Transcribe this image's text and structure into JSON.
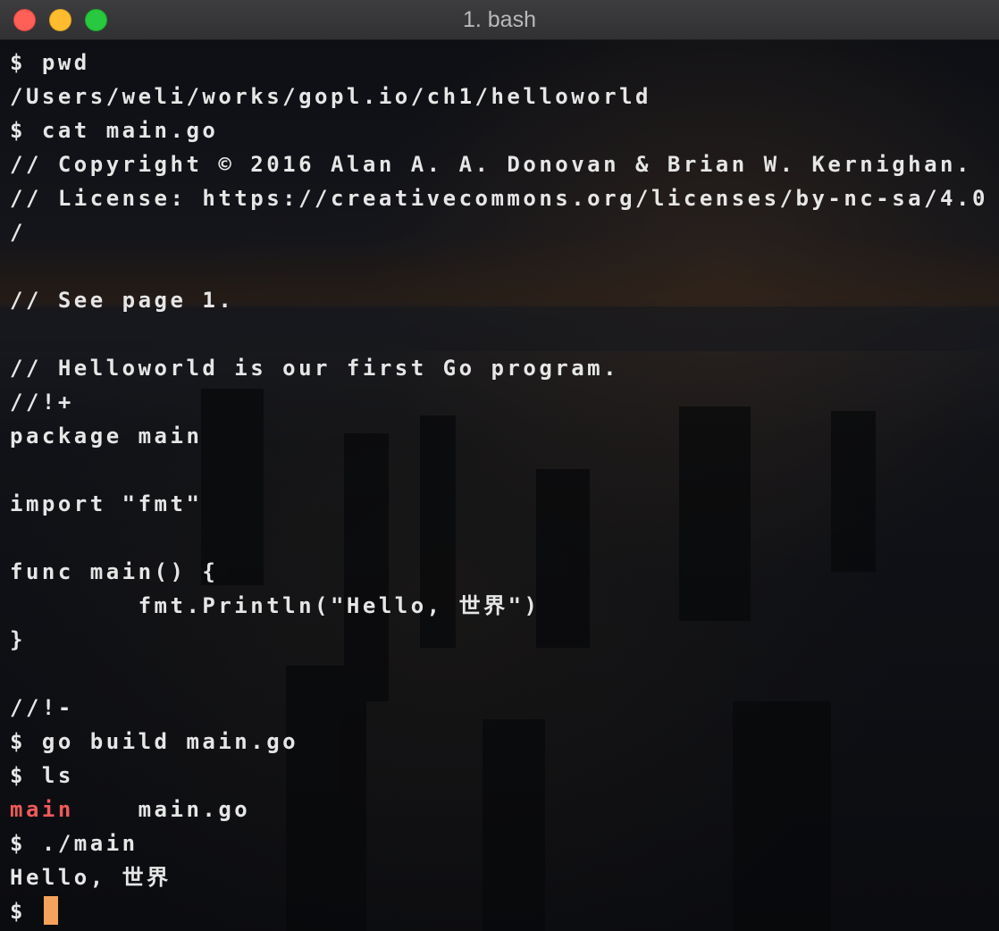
{
  "window": {
    "title": "1. bash"
  },
  "colors": {
    "text": "#e6e6e6",
    "executable": "#f05a5a",
    "cursor": "#f5a25c"
  },
  "terminal": {
    "lines": [
      "$ pwd",
      "/Users/weli/works/gopl.io/ch1/helloworld",
      "$ cat main.go",
      "// Copyright © 2016 Alan A. A. Donovan & Brian W. Kernighan.",
      "// License: https://creativecommons.org/licenses/by-nc-sa/4.0",
      "/",
      "",
      "// See page 1.",
      "",
      "// Helloworld is our first Go program.",
      "//!+",
      "package main",
      "",
      "import \"fmt\"",
      "",
      "func main() {",
      "        fmt.Println(\"Hello, 世界\")",
      "}",
      "",
      "//!-",
      "$ go build main.go",
      "$ ls"
    ],
    "ls_output": {
      "executable": "main",
      "separator": "    ",
      "file": "main.go"
    },
    "after_lines": [
      "$ ./main",
      "Hello, 世界"
    ],
    "prompt": "$ "
  }
}
